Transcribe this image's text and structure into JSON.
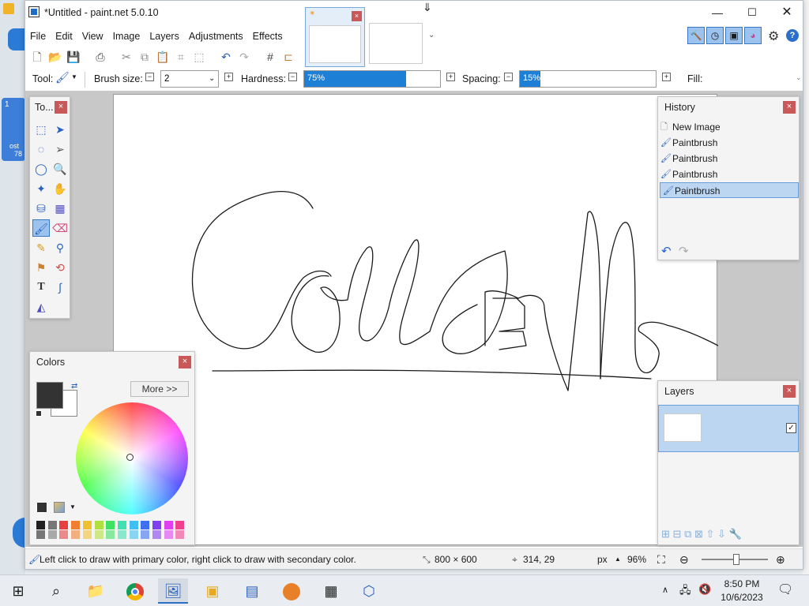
{
  "window": {
    "title": "*Untitled - paint.net 5.0.10"
  },
  "menu": [
    "File",
    "Edit",
    "View",
    "Image",
    "Layers",
    "Adjustments",
    "Effects"
  ],
  "toolbar": {
    "tool_label": "Tool:",
    "brush_size_label": "Brush size:",
    "brush_size_value": "2",
    "hardness_label": "Hardness:",
    "hardness_value": "75%",
    "hardness_pct": 75,
    "spacing_label": "Spacing:",
    "spacing_value": "15%",
    "spacing_pct": 15,
    "fill_label": "Fill:"
  },
  "tools_panel": {
    "title": "To..."
  },
  "history": {
    "title": "History",
    "items": [
      "New Image",
      "Paintbrush",
      "Paintbrush",
      "Paintbrush",
      "Paintbrush"
    ]
  },
  "layers": {
    "title": "Layers"
  },
  "colors": {
    "title": "Colors",
    "more_label": "More >>",
    "primary": "#333333",
    "secondary": "#ffffff"
  },
  "status": {
    "hint": "Left click to draw with primary color, right click to draw with secondary color.",
    "image_size": "800 × 600",
    "cursor_pos": "314, 29",
    "unit": "px",
    "zoom": "96%"
  },
  "taskbar": {
    "time": "8:50 PM",
    "date": "10/6/2023"
  },
  "background": {
    "thumb_number": "1",
    "thumb_label": "ost",
    "thumb_sub": "78"
  }
}
